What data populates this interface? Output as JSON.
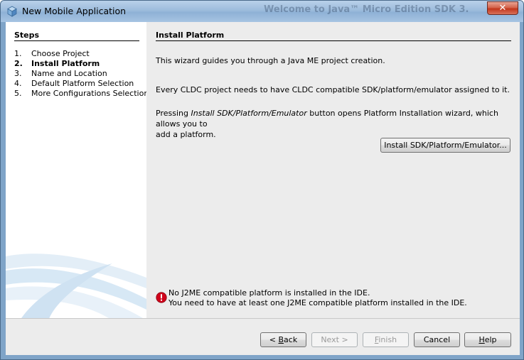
{
  "window": {
    "title": "New Mobile Application",
    "background_title_ghost": "Welcome to Java™ Micro Edition SDK 3.",
    "close_icon": "close-icon"
  },
  "steps": {
    "heading": "Steps",
    "items": [
      {
        "num": "1.",
        "label": "Choose Project"
      },
      {
        "num": "2.",
        "label": "Install Platform"
      },
      {
        "num": "3.",
        "label": "Name and Location"
      },
      {
        "num": "4.",
        "label": "Default Platform Selection"
      },
      {
        "num": "5.",
        "label": "More Configurations Selection"
      }
    ],
    "current_index": 1
  },
  "main": {
    "heading": "Install Platform",
    "intro": "This wizard guides you through a Java ME project creation.",
    "requirement": "Every CLDC project needs to have CLDC compatible SDK/platform/emulator assigned to it.",
    "pressing_prefix": "Pressing ",
    "pressing_button_name": "Install SDK/Platform/Emulator",
    "pressing_suffix": " button opens Platform Installation wizard, which allows you to",
    "pressing_line2": "add a platform.",
    "install_button": "Install SDK/Platform/Emulator...",
    "error_line1": "No J2ME compatible platform is installed in the IDE.",
    "error_line2": "You need to have at least one J2ME compatible platform installed in the IDE.",
    "error_icon": "error-icon"
  },
  "footer": {
    "back_lt": "< ",
    "back_mn": "B",
    "back_rest": "ack",
    "next": "Next >",
    "finish_mn": "F",
    "finish_rest": "inish",
    "cancel": "Cancel",
    "help_mn": "H",
    "help_rest": "elp"
  },
  "colors": {
    "titlebar": "#9dbcdc",
    "close": "#c2361c",
    "dialog_bg": "#ececec",
    "steps_bg": "#ffffff",
    "error_red": "#d0021b"
  }
}
